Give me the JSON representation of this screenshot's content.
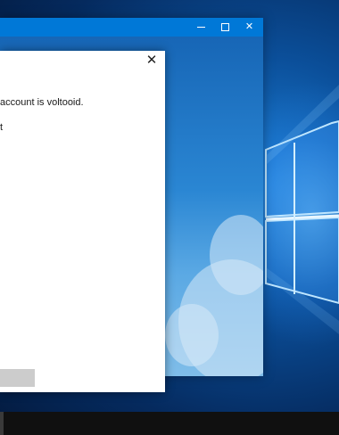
{
  "back_window": {
    "title_buttons": {
      "minimize_icon": "minimize-icon",
      "maximize_icon": "maximize-icon",
      "close_icon": "close-icon",
      "close_glyph": "✕"
    },
    "titlebar_color": "#0078d7"
  },
  "dialog": {
    "close_glyph": "✕",
    "message_line1": "account is voltooid.",
    "message_line2": "t",
    "button_label": ""
  },
  "desktop": {
    "wallpaper": "windows-10-hero",
    "accent_color": "#0078d7"
  },
  "taskbar": {
    "color": "#101010"
  }
}
